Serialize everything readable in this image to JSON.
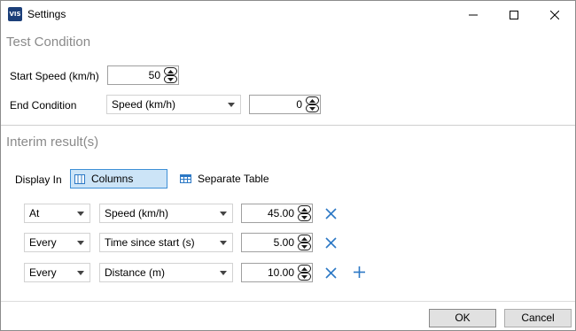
{
  "window": {
    "title": "Settings",
    "app_icon_text": "VIS"
  },
  "test_condition": {
    "title": "Test Condition",
    "start_speed": {
      "label": "Start Speed (km/h)",
      "value": "50"
    },
    "end_condition": {
      "label": "End Condition",
      "type": "Speed (km/h)",
      "value": "0"
    }
  },
  "interim": {
    "title": "Interim result(s)",
    "display_in": {
      "label": "Display In",
      "options": [
        {
          "label": "Columns",
          "selected": true
        },
        {
          "label": "Separate Table",
          "selected": false
        }
      ]
    },
    "rows": [
      {
        "mode": "At",
        "quantity": "Speed (km/h)",
        "value": "45.00"
      },
      {
        "mode": "Every",
        "quantity": "Time since start (s)",
        "value": "5.00"
      },
      {
        "mode": "Every",
        "quantity": "Distance (m)",
        "value": "10.00"
      }
    ]
  },
  "footer": {
    "ok_label": "OK",
    "cancel_label": "Cancel"
  },
  "colors": {
    "accent": "#2b78c5",
    "selected_bg": "#cce4f7",
    "section_title": "#8a8a8a"
  }
}
